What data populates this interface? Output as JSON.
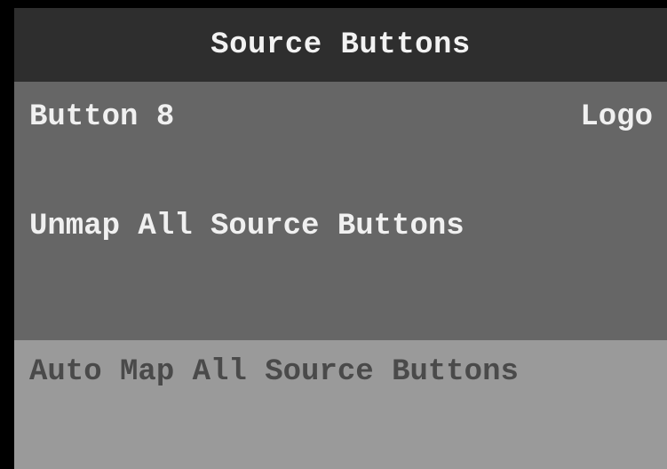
{
  "header": {
    "title": "Source Buttons"
  },
  "selected_button": {
    "name": "Button 8",
    "mapped_source": "Logo"
  },
  "actions": {
    "unmap_label": "Unmap All Source Buttons",
    "automap_label": "Auto Map All Source Buttons"
  },
  "colors": {
    "background": "#000000",
    "header_bg": "#2e2e2e",
    "panel_bg": "#666666",
    "automap_bg": "#9a9a9a",
    "text_light": "#f0f0f0",
    "text_dark": "#4a4a4a"
  }
}
